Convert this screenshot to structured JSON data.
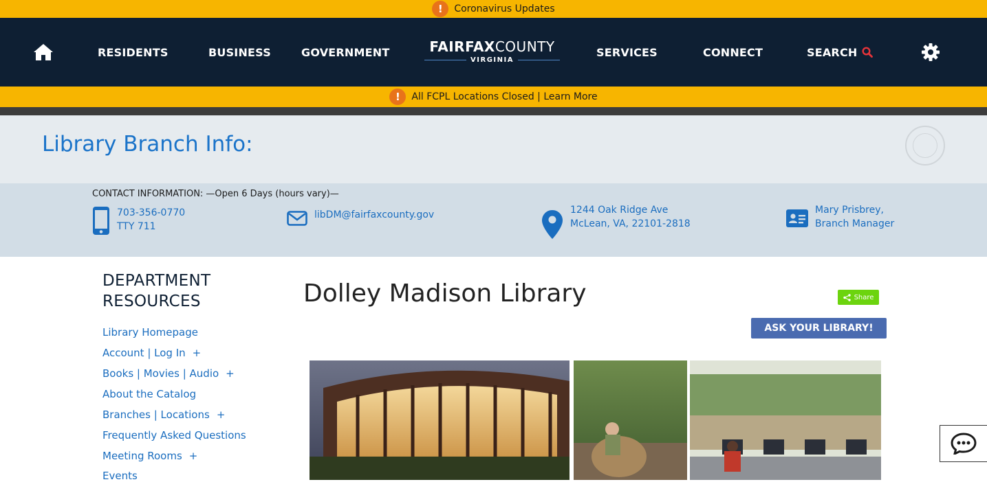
{
  "alerts": {
    "top": "Coronavirus Updates",
    "second": "All FCPL Locations Closed | Learn More"
  },
  "nav": {
    "residents": "RESIDENTS",
    "business": "BUSINESS",
    "government": "GOVERNMENT",
    "services": "SERVICES",
    "connect": "CONNECT",
    "search": "SEARCH",
    "logo_bold": "FAIRFAX",
    "logo_thin": "COUNTY",
    "logo_sub": "VIRGINIA"
  },
  "branch": {
    "title": "Library Branch Info:"
  },
  "contact": {
    "label": "CONTACT INFORMATION: —Open 6 Days (hours vary)—",
    "phone": "703-356-0770",
    "tty": "TTY 711",
    "email": "libDM@fairfaxcounty.gov",
    "address_line1": "1244 Oak Ridge Ave",
    "address_line2": "McLean, VA, 22101-2818",
    "manager_name": "Mary Prisbrey,",
    "manager_title": "Branch Manager"
  },
  "sidebar": {
    "title_line1": "DEPARTMENT",
    "title_line2": "RESOURCES",
    "items": [
      {
        "label": "Library Homepage",
        "plus": ""
      },
      {
        "label": "Account | Log In",
        "plus": "+"
      },
      {
        "label": "Books | Movies | Audio",
        "plus": "+"
      },
      {
        "label": "About the Catalog",
        "plus": ""
      },
      {
        "label": "Branches | Locations",
        "plus": "+"
      },
      {
        "label": "Frequently Asked Questions",
        "plus": ""
      },
      {
        "label": "Meeting Rooms",
        "plus": "+"
      },
      {
        "label": "Events",
        "plus": ""
      }
    ]
  },
  "main": {
    "title": "Dolley Madison Library",
    "share_label": "Share",
    "ask_label": "ASK YOUR LIBRARY!"
  },
  "icons": {
    "home": "home-icon",
    "search": "search-icon",
    "settings": "gear-icon",
    "phone": "mobile-phone-icon",
    "email": "envelope-icon",
    "location": "map-pin-icon",
    "manager": "id-card-icon",
    "chat": "chat-bubble-icon",
    "alert": "exclamation-icon"
  },
  "colors": {
    "alert_bar": "#f7b500",
    "nav_bg": "#0e1f33",
    "link_blue": "#1a6dbf",
    "title_blue": "#1a73c9",
    "search_accent": "#e8343a",
    "share_green": "#6cd40e",
    "ask_button": "#4a6bb0"
  }
}
